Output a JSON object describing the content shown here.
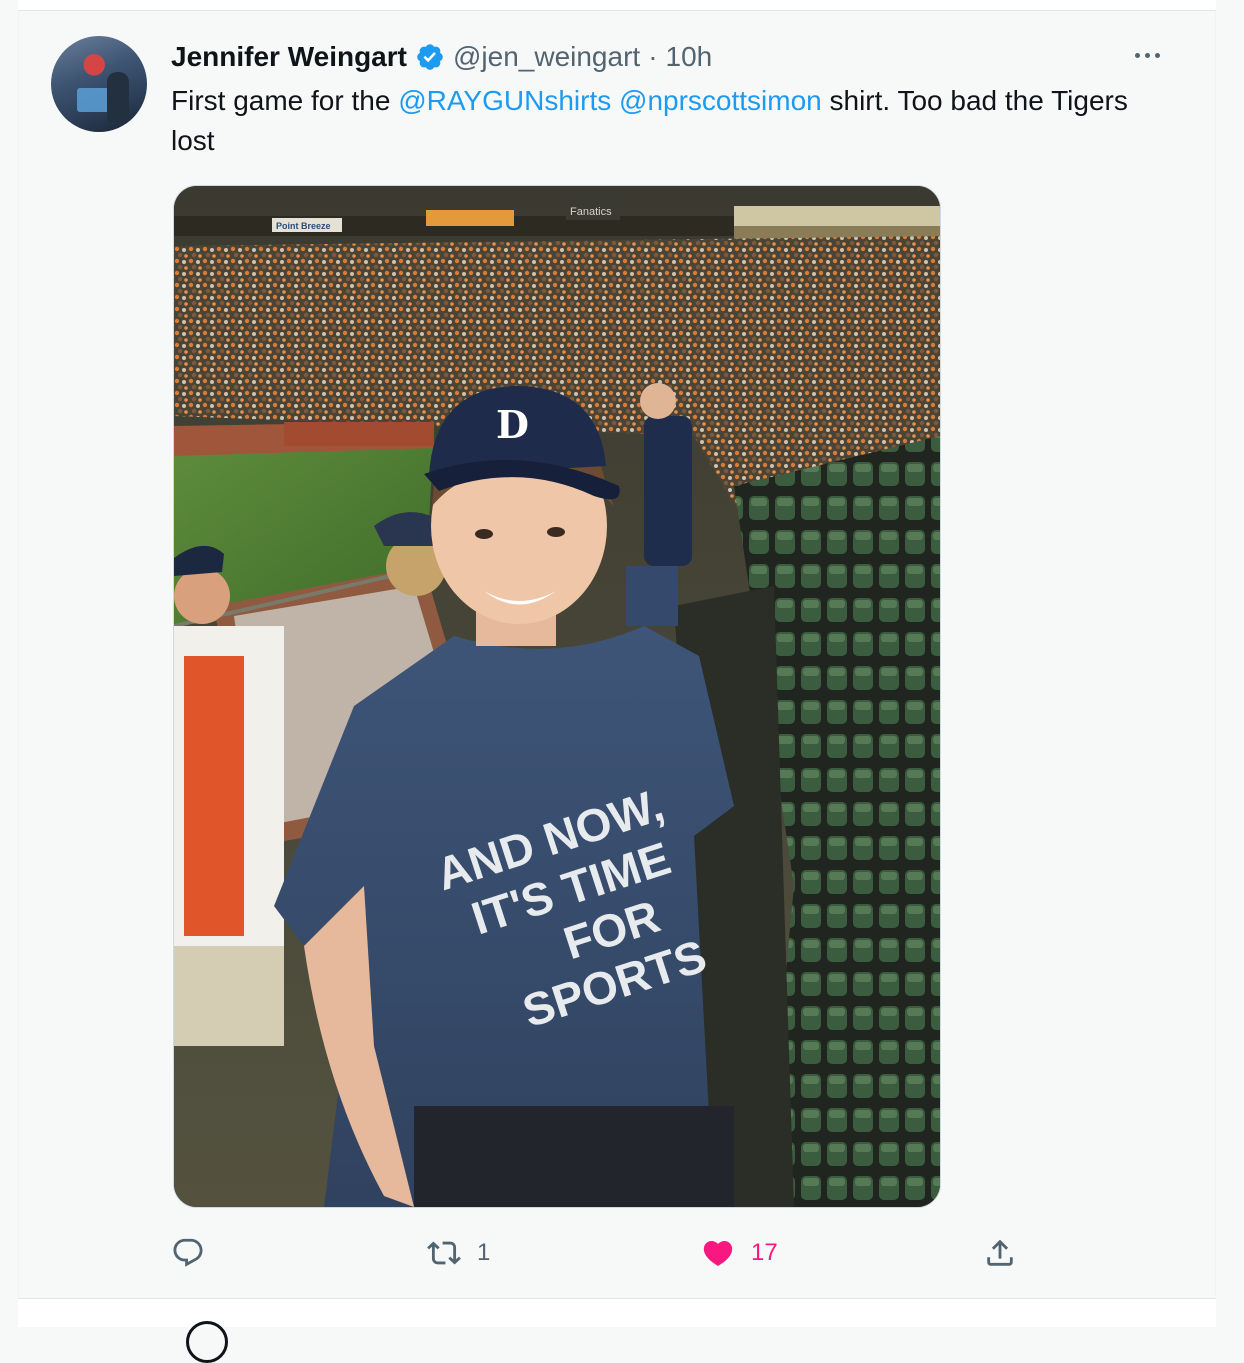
{
  "tweet": {
    "display_name": "Jennifer Weingart",
    "handle": "@jen_weingart",
    "separator": "·",
    "time": "10h",
    "text_before": "First game for the ",
    "mention_1": "@RAYGUNshirts",
    "text_space": " ",
    "mention_2": "@nprscottsimon",
    "text_after": " shirt. Too bad the Tigers lost",
    "photo": {
      "shirt_text_1": "AND NOW,",
      "shirt_text_2": "IT'S TIME",
      "shirt_text_3": "FOR",
      "shirt_text_4": "SPORTS",
      "sign_1": "Point Breeze",
      "sign_2": "Fanatics"
    }
  },
  "actions": {
    "reply_count": "",
    "retweet_count": "1",
    "like_count": "17",
    "share_count": ""
  },
  "colors": {
    "link": "#1d9bf0",
    "like": "#f91880",
    "muted": "#536471",
    "verified": "#1d9bf0"
  },
  "icons": [
    "verified-badge-icon",
    "more-options-icon",
    "reply-icon",
    "retweet-icon",
    "heart-icon",
    "share-icon"
  ]
}
